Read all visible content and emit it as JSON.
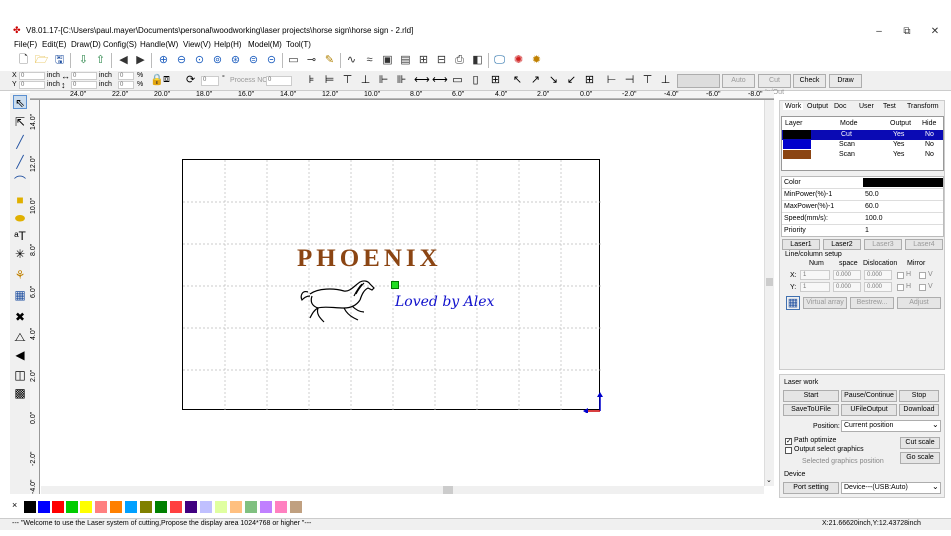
{
  "window": {
    "title": "V8.01.17-[C:\\Users\\paul.mayer\\Documents\\personal\\woodworking\\laser projects\\horse sign\\horse sign - 2.rld]",
    "minimize": "–",
    "maximize": "⧉",
    "close": "✕"
  },
  "menu": [
    "File(F)",
    "Edit(E)",
    "Draw(D)",
    "Config(S)",
    "Handle(W)",
    "View(V)",
    "Help(H)",
    "Model(M)",
    "Tool(T)"
  ],
  "posbar": {
    "x_label": "X",
    "y_label": "Y",
    "x_value": "0",
    "y_value": "0",
    "w_value": "0",
    "h_value": "0",
    "unit_x": "inch",
    "unit_y": "inch",
    "unit_w": "inch",
    "unit_h": "inch",
    "pct_x": "0",
    "pct_y": "0",
    "pct_sym": "%",
    "rotation": "0",
    "degree": "°",
    "process_no_label": "Process NO:",
    "process_no": "0",
    "auto": "Auto",
    "cut_in_out": "Cut In/Out",
    "check": "Check",
    "draw": "Draw"
  },
  "ruler_h": [
    "24.0\"",
    "22.0\"",
    "20.0\"",
    "18.0\"",
    "16.0\"",
    "14.0\"",
    "12.0\"",
    "10.0\"",
    "8.0\"",
    "6.0\"",
    "4.0\"",
    "2.0\"",
    "0.0\"",
    "-2.0\"",
    "-4.0\"",
    "-6.0\"",
    "-8.0\""
  ],
  "ruler_v": [
    "14.0\"",
    "12.0\"",
    "10.0\"",
    "8.0\"",
    "6.0\"",
    "4.0\"",
    "2.0\"",
    "0.0\"",
    "-2.0\"",
    "-4.0\""
  ],
  "design": {
    "title_text": "PHOENIX",
    "subtitle_text": "Loved by Alex"
  },
  "palette": {
    "x_mark": "×",
    "colors": [
      "#000000",
      "#0000ff",
      "#ff0000",
      "#00cc00",
      "#ffff00",
      "#ff8080",
      "#ff8000",
      "#00a0ff",
      "#808000",
      "#008000",
      "#ff4040",
      "#400080",
      "#c0c0ff",
      "#e0ffa0",
      "#ffc080",
      "#80c080",
      "#c080ff",
      "#ff80c0",
      "#c0a080"
    ]
  },
  "status": {
    "message": "--- \"Welcome to use the Laser system of cutting,Propose the display area 1024*768 or higher \"---",
    "coords": "X:21.66620inch,Y:12.43728inch"
  },
  "panel": {
    "tabs": [
      "Work",
      "Output",
      "Doc",
      "User",
      "Test",
      "Transform"
    ],
    "layer_headers": [
      "Layer",
      "Mode",
      "Output",
      "Hide"
    ],
    "layers": [
      {
        "color": "#000000",
        "mode": "Cut",
        "output": "Yes",
        "hide": "No",
        "selected": true
      },
      {
        "color": "#0000cc",
        "mode": "Scan",
        "output": "Yes",
        "hide": "No",
        "selected": false
      },
      {
        "color": "#8B4513",
        "mode": "Scan",
        "output": "Yes",
        "hide": "No",
        "selected": false
      }
    ],
    "props": [
      {
        "label": "Color",
        "value": ""
      },
      {
        "label": "MinPower(%)-1",
        "value": "50.0"
      },
      {
        "label": "MaxPower(%)-1",
        "value": "60.0"
      },
      {
        "label": "Speed(mm/s):",
        "value": "100.0"
      },
      {
        "label": "Priority",
        "value": "1"
      }
    ],
    "prop_color": "#000000",
    "laser_buttons": [
      "Laser1",
      "Laser2",
      "Laser3",
      "Laser4"
    ],
    "line_column": "Line/column setup",
    "lc_headers": [
      "Num",
      "space",
      "Dislocation",
      "Mirror"
    ],
    "x_label": "X:",
    "y_label": "Y:",
    "x_num": "1",
    "x_space": "0.000",
    "x_disloc": "0.000",
    "y_num": "1",
    "y_space": "0.000",
    "y_disloc": "0.000",
    "mirror_h": "H",
    "mirror_v": "V",
    "virtual_array": "Virtual array",
    "bestrew": "Bestrew...",
    "adjust": "Adjust"
  },
  "laserwork": {
    "title": "Laser work",
    "start": "Start",
    "pause": "Pause/Continue",
    "stop": "Stop",
    "save_u": "SaveToUFile",
    "ufile_out": "UFileOutput",
    "download": "Download",
    "position_label": "Position:",
    "position_value": "Current position",
    "path_optimize": "Path optimize",
    "output_select": "Output select graphics",
    "selected_pos": "Selected graphics position",
    "cut_scale": "Cut scale",
    "go_scale": "Go scale",
    "device_label": "Device",
    "port_setting": "Port setting",
    "device_value": "Device---(USB:Auto)"
  }
}
